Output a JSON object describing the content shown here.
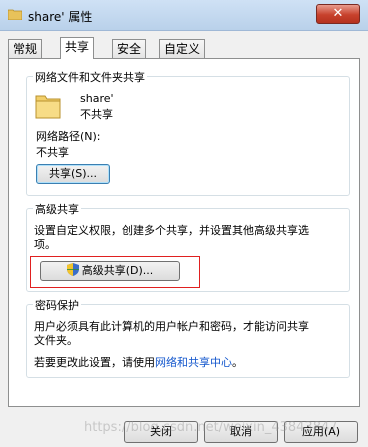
{
  "window": {
    "title": "share' 属性",
    "close_glyph": "✕",
    "title_icon": "folder-icon"
  },
  "tabs": [
    {
      "label": "常规",
      "active": false
    },
    {
      "label": "共享",
      "active": true
    },
    {
      "label": "安全",
      "active": false
    },
    {
      "label": "自定义",
      "active": false
    }
  ],
  "network_sharing": {
    "title": "网络文件和文件夹共享",
    "folder_name": "share'",
    "share_status": "不共享",
    "path_label": "网络路径(N):",
    "path_value": "不共享",
    "share_button": "共享(S)..."
  },
  "advanced_sharing": {
    "title": "高级共享",
    "description_line1": "设置自定义权限，创建多个共享，并设置其他高级共享选",
    "description_line2": "项。",
    "button": "高级共享(D)...",
    "button_icon": "uac-shield-icon"
  },
  "password": {
    "title": "密码保护",
    "description_line1": "用户必须具有此计算机的用户帐户和密码，才能访问共享",
    "description_line2": "文件夹。",
    "change_prefix": "若要更改此设置，请使用",
    "change_link": "网络和共享中心",
    "change_suffix": "。"
  },
  "footer": {
    "close": "关闭",
    "cancel": "取消",
    "apply": "应用(A)",
    "watermark": "https://blog.csdn.net/weixin_43843847"
  },
  "colors": {
    "highlight_box": "#e02020",
    "link": "#1155cc",
    "close_button": "#c7412c"
  }
}
